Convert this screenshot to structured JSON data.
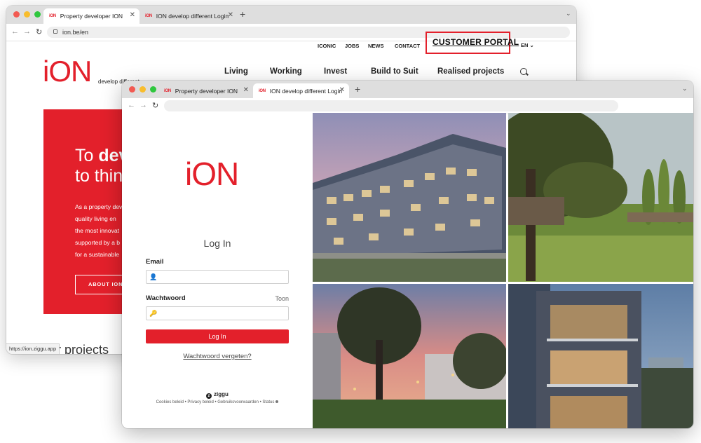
{
  "back_window": {
    "tabs": [
      {
        "title": "Property developer ION",
        "favicon": "iON"
      },
      {
        "title": "ION develop different Login",
        "favicon": "iON"
      }
    ],
    "url": "ion.be/en",
    "top_links": [
      "ICONIC",
      "JOBS",
      "NEWS",
      "CONTACT"
    ],
    "customer_portal": "CUSTOMER PORTAL",
    "language": "EN",
    "logo": "iON",
    "logo_tagline": "develop different",
    "main_nav": [
      "Living",
      "Working",
      "Invest",
      "Build to Suit",
      "Realised projects"
    ],
    "hero": {
      "heading_line1_a": "To ",
      "heading_line1_b": "dev",
      "heading_line2": "to thin",
      "paragraph_lines": [
        "As a property dev",
        "quality living en",
        "the most innovat",
        "supported by a b",
        "for a sustainable"
      ],
      "button": "ABOUT ION"
    },
    "status_url": "https://ion.ziggu.app",
    "projects_heading": "ur projects"
  },
  "front_window": {
    "tabs": [
      {
        "title": "Property developer ION",
        "favicon": "iON"
      },
      {
        "title": "ION develop different Login",
        "favicon": "iON"
      }
    ],
    "logo": "iON",
    "login": {
      "title": "Log In",
      "email_label": "Email",
      "password_label": "Wachtwoord",
      "show_label": "Toon",
      "submit": "Log In",
      "forgot": "Wachtwoord vergeten?",
      "brand": "ziggu",
      "footer_links": "Cookies beleid • Privacy beleid • Gebruiksvoorwaarden • Status"
    }
  },
  "icons": [
    "back-arrow-icon",
    "forward-arrow-icon",
    "reload-icon",
    "lock-icon",
    "search-icon",
    "user-icon",
    "key-icon",
    "chevron-down-icon",
    "close-icon",
    "plus-icon"
  ],
  "colors": {
    "brand_red": "#e3202b",
    "tabbar": "#dedede"
  }
}
